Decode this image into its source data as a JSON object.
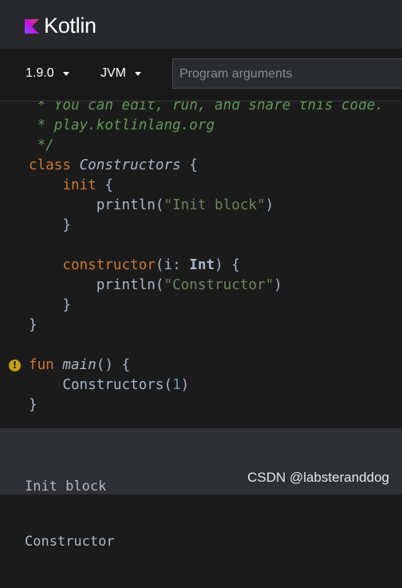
{
  "header": {
    "logo_text": "Kotlin",
    "logo_icon": "kotlin-logo-icon"
  },
  "toolbar": {
    "version": "1.9.0",
    "target": "JVM",
    "args_placeholder": "Program arguments",
    "args_value": ""
  },
  "editor": {
    "warning_icon": "warning-icon",
    "lines": [
      [
        [
          " * You can edit, run, and share this code.",
          "comment"
        ]
      ],
      [
        [
          " * play.kotlinlang.org",
          "comment"
        ]
      ],
      [
        [
          " */",
          "comment"
        ]
      ],
      [
        [
          "class",
          "kw"
        ],
        [
          " ",
          "plain"
        ],
        [
          "Constructors",
          "cls"
        ],
        [
          " {",
          "plain"
        ]
      ],
      [
        [
          "    ",
          "plain"
        ],
        [
          "init",
          "kw"
        ],
        [
          " {",
          "plain"
        ]
      ],
      [
        [
          "        println(",
          "plain"
        ],
        [
          "\"Init block\"",
          "str"
        ],
        [
          ")",
          "plain"
        ]
      ],
      [
        [
          "    }",
          "plain"
        ]
      ],
      [
        [
          "",
          "plain"
        ]
      ],
      [
        [
          "    ",
          "plain"
        ],
        [
          "constructor",
          "kw"
        ],
        [
          "(i: ",
          "plain"
        ],
        [
          "Int",
          "type"
        ],
        [
          ") {",
          "plain"
        ]
      ],
      [
        [
          "        println(",
          "plain"
        ],
        [
          "\"Constructor\"",
          "str"
        ],
        [
          ")",
          "plain"
        ]
      ],
      [
        [
          "    }",
          "plain"
        ]
      ],
      [
        [
          "}",
          "plain"
        ]
      ],
      [
        [
          "",
          "plain"
        ]
      ],
      [
        [
          "fun",
          "kw"
        ],
        [
          " ",
          "plain"
        ],
        [
          "main",
          "fn"
        ],
        [
          "() {",
          "plain"
        ]
      ],
      [
        [
          "    Constructors(",
          "plain"
        ],
        [
          "1",
          "num"
        ],
        [
          ")",
          "plain"
        ]
      ],
      [
        [
          "}",
          "plain"
        ]
      ]
    ]
  },
  "output": {
    "lines": [
      "Init block",
      "Constructor"
    ]
  },
  "watermark": "CSDN @labsteranddog",
  "colors": {
    "keyword": "#cc7832",
    "string": "#6a8759",
    "comment": "#629755",
    "number": "#6897bb",
    "warning": "#c7a012"
  }
}
